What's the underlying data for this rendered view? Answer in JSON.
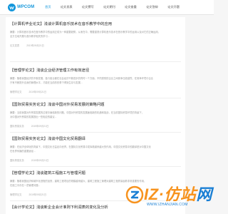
{
  "header": {
    "logo_text": "WPCOM",
    "nav": [
      "首页",
      "论文发表",
      "论文撰写",
      "论文期刊",
      "论文查重",
      "论文答辩",
      "论文开题"
    ],
    "active_index": 0,
    "brand_color": "#1296db"
  },
  "articles": [
    {
      "title": "【计算机毕业论文】浅谈计算机音乐技术在音乐教学中的应用",
      "summary_lines": [
        "摘要：计算机音乐技术在音乐教学中的运用正成为一种重要趋势，从而在中，需要重视计算机音乐技术在音乐教学中的运用以及对它的正确运用，",
        "全方位地开展与音乐教学相关的学习..."
      ],
      "meta": [
        "论文发表",
        "2019年09月21日"
      ]
    },
    {
      "title": "【管理学论文】浅谈企业经济管理工作有效途径",
      "summary_lines": [
        "摘要：随着我国经济的不断发展，各行各业都在社会经济不断进步的同时一个方面，不同类别的企业之间竞争日趋激烈，在竞争环境中企业",
        "只有不断提升自身的管理水平，才能在当前的形势下得到生存与发展..."
      ],
      "meta": [
        "管理学论文",
        "2019年09月21日"
      ]
    },
    {
      "title": "【国际贸易实务论文】浅谈中国对外贸易发展的策略问题",
      "summary_lines": [
        "摘要：当前我国对外贸易发展的过程中面临新的问题，中国对外贸易的发展面临新的机遇和挑战，在当前国际贸易环境的背景下，",
        "对中国对外贸易的发展提出一些相应的建议..."
      ],
      "meta": [
        "国际贸易实务",
        "2019年09月21日"
      ]
    },
    {
      "title": "【国际贸易实务论文】浅谈中国文化贸易翻译",
      "summary_lines": [
        "摘要：在经济全球化的背景下，中国文化日益走向世界，在国际文化贸易中发挥着越来越大的作用，中国文化贸易中的翻译是对中国文化",
        "在世界传播的重要途径..."
      ],
      "meta": [
        "国际贸易实务",
        "2019年09月21日"
      ]
    },
    {
      "title": "【管理学论文】浅谈建筑工程施工与管理问题",
      "summary_lines": [
        "摘要：随着我国经济和城市化进程的加快，建筑工程项目的规模越来越大，建筑工程施工管理对建筑工程质量起着非常重要的作用，",
        "在施工中存在一些管理问题..."
      ],
      "meta": [
        "管理学论文",
        "2019年09月21日"
      ]
    },
    {
      "title": "【会计学论文】浅谈新企业会计准则下利润表的变化及分析",
      "summary_lines": [],
      "meta": []
    }
  ],
  "watermark": {
    "main": "IZ·仿站",
    "tail": "网",
    "url": "WWW.IZHANJIAN.COM",
    "orange": "#f7931e",
    "blue": "#1a7fd4"
  }
}
